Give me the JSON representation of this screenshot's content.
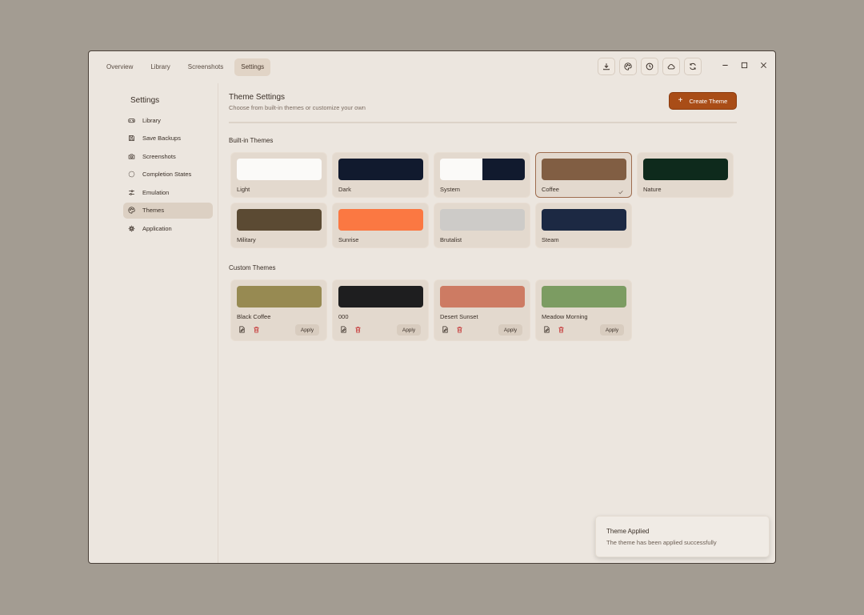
{
  "tabs": [
    {
      "label": "Overview",
      "active": false
    },
    {
      "label": "Library",
      "active": false
    },
    {
      "label": "Screenshots",
      "active": false
    },
    {
      "label": "Settings",
      "active": true
    }
  ],
  "toolbar": {
    "icons": [
      "download-icon",
      "palette-icon",
      "clock-icon",
      "cloud-icon",
      "refresh-icon"
    ]
  },
  "window_controls": [
    "minimize-icon",
    "maximize-icon",
    "close-icon"
  ],
  "sidebar": {
    "title": "Settings",
    "items": [
      {
        "label": "Library",
        "icon": "gamepad-icon",
        "active": false
      },
      {
        "label": "Save Backups",
        "icon": "save-icon",
        "active": false
      },
      {
        "label": "Screenshots",
        "icon": "camera-icon",
        "active": false
      },
      {
        "label": "Completion States",
        "icon": "dashed-circle-icon",
        "active": false
      },
      {
        "label": "Emulation",
        "icon": "sliders-icon",
        "active": false
      },
      {
        "label": "Themes",
        "icon": "palette-icon",
        "active": true
      },
      {
        "label": "Application",
        "icon": "gear-icon",
        "active": false
      }
    ]
  },
  "main": {
    "title": "Theme Settings",
    "subtitle": "Choose from built-in themes or customize your own",
    "create_button": "Create Theme",
    "builtin_title": "Built-in Themes",
    "custom_title": "Custom Themes",
    "builtin_themes": [
      {
        "name": "Light",
        "colors": [
          "#fbfaf8"
        ],
        "selected": false
      },
      {
        "name": "Dark",
        "colors": [
          "#111a2e"
        ],
        "selected": false
      },
      {
        "name": "System",
        "colors": [
          "#fbfaf8",
          "#111a2e"
        ],
        "selected": false
      },
      {
        "name": "Coffee",
        "colors": [
          "#815e43"
        ],
        "selected": true
      },
      {
        "name": "Nature",
        "colors": [
          "#0e2a1c"
        ],
        "selected": false
      },
      {
        "name": "Military",
        "colors": [
          "#5b4a33"
        ],
        "selected": false
      },
      {
        "name": "Sunrise",
        "colors": [
          "#fb7842"
        ],
        "selected": false
      },
      {
        "name": "Brutalist",
        "colors": [
          "#cdcbc8"
        ],
        "selected": false
      },
      {
        "name": "Steam",
        "colors": [
          "#1c2943"
        ],
        "selected": false
      }
    ],
    "custom_themes": [
      {
        "name": "Black Coffee",
        "colors": [
          "#978a52"
        ],
        "apply": "Apply"
      },
      {
        "name": "000",
        "colors": [
          "#1e1e1f"
        ],
        "apply": "Apply"
      },
      {
        "name": "Desert Sunset",
        "colors": [
          "#cd7b63"
        ],
        "apply": "Apply"
      },
      {
        "name": "Meadow Morning",
        "colors": [
          "#7c9c62"
        ],
        "apply": "Apply"
      }
    ]
  },
  "toast": {
    "title": "Theme Applied",
    "message": "The theme has been applied successfully"
  },
  "colors": {
    "accent": "#a94d17",
    "background": "#ece6df",
    "delete": "#c63a3a"
  }
}
